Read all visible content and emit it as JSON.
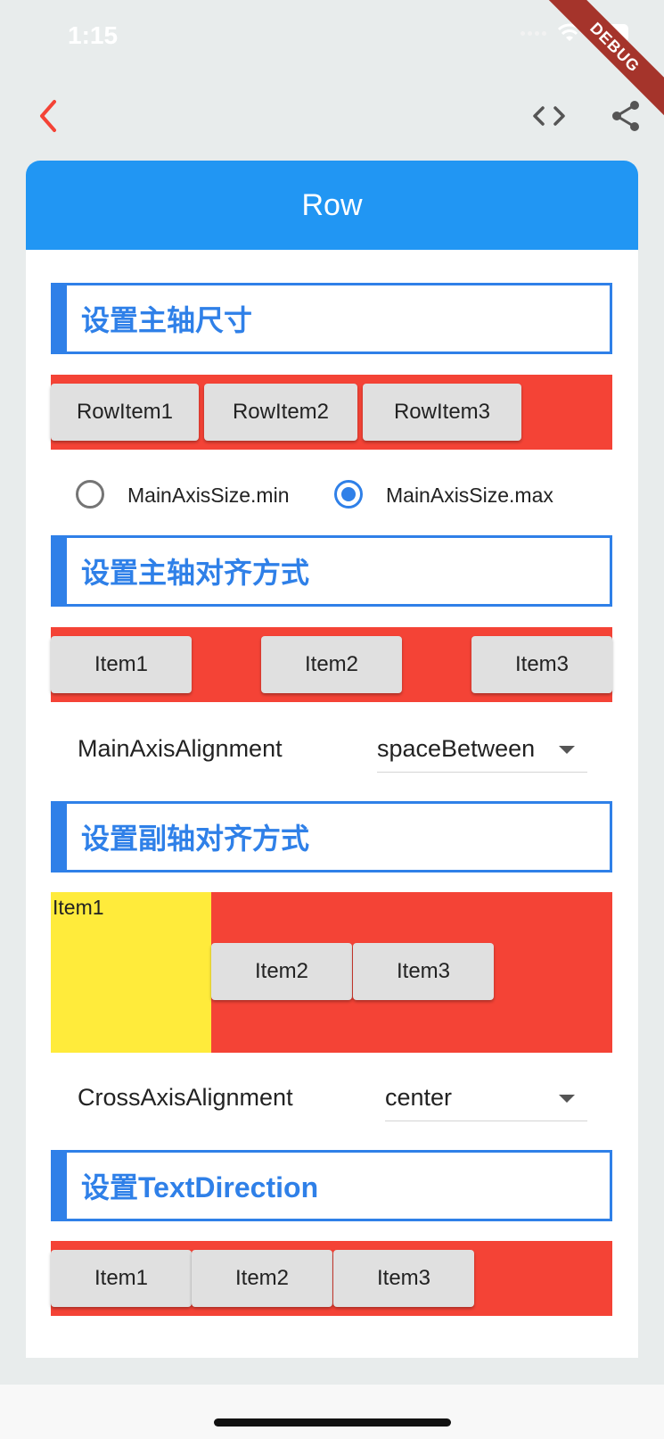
{
  "status_bar": {
    "time": "1:15",
    "debug_label": "DEBUG"
  },
  "app_bar": {
    "back_icon": "chevron-left-icon",
    "code_icon": "code-icon",
    "share_icon": "share-icon"
  },
  "card": {
    "title": "Row"
  },
  "sections": {
    "main_axis_size": {
      "title": "设置主轴尺寸",
      "items": [
        "RowItem1",
        "RowItem2",
        "RowItem3"
      ],
      "options": [
        "MainAxisSize.min",
        "MainAxisSize.max"
      ],
      "selected": "MainAxisSize.max"
    },
    "main_axis_alignment": {
      "title": "设置主轴对齐方式",
      "items": [
        "Item1",
        "Item2",
        "Item3"
      ],
      "label": "MainAxisAlignment",
      "value": "spaceBetween"
    },
    "cross_axis_alignment": {
      "title": "设置副轴对齐方式",
      "items": [
        "Item1",
        "Item2",
        "Item3"
      ],
      "label": "CrossAxisAlignment",
      "value": "center"
    },
    "text_direction": {
      "title": "设置TextDirection",
      "items": [
        "Item1",
        "Item2",
        "Item3"
      ]
    }
  },
  "colors": {
    "primary": "#2196f3",
    "accent": "#2f80e8",
    "red": "#f44336",
    "yellow": "#ffeb3b",
    "back_icon": "#f44336"
  }
}
